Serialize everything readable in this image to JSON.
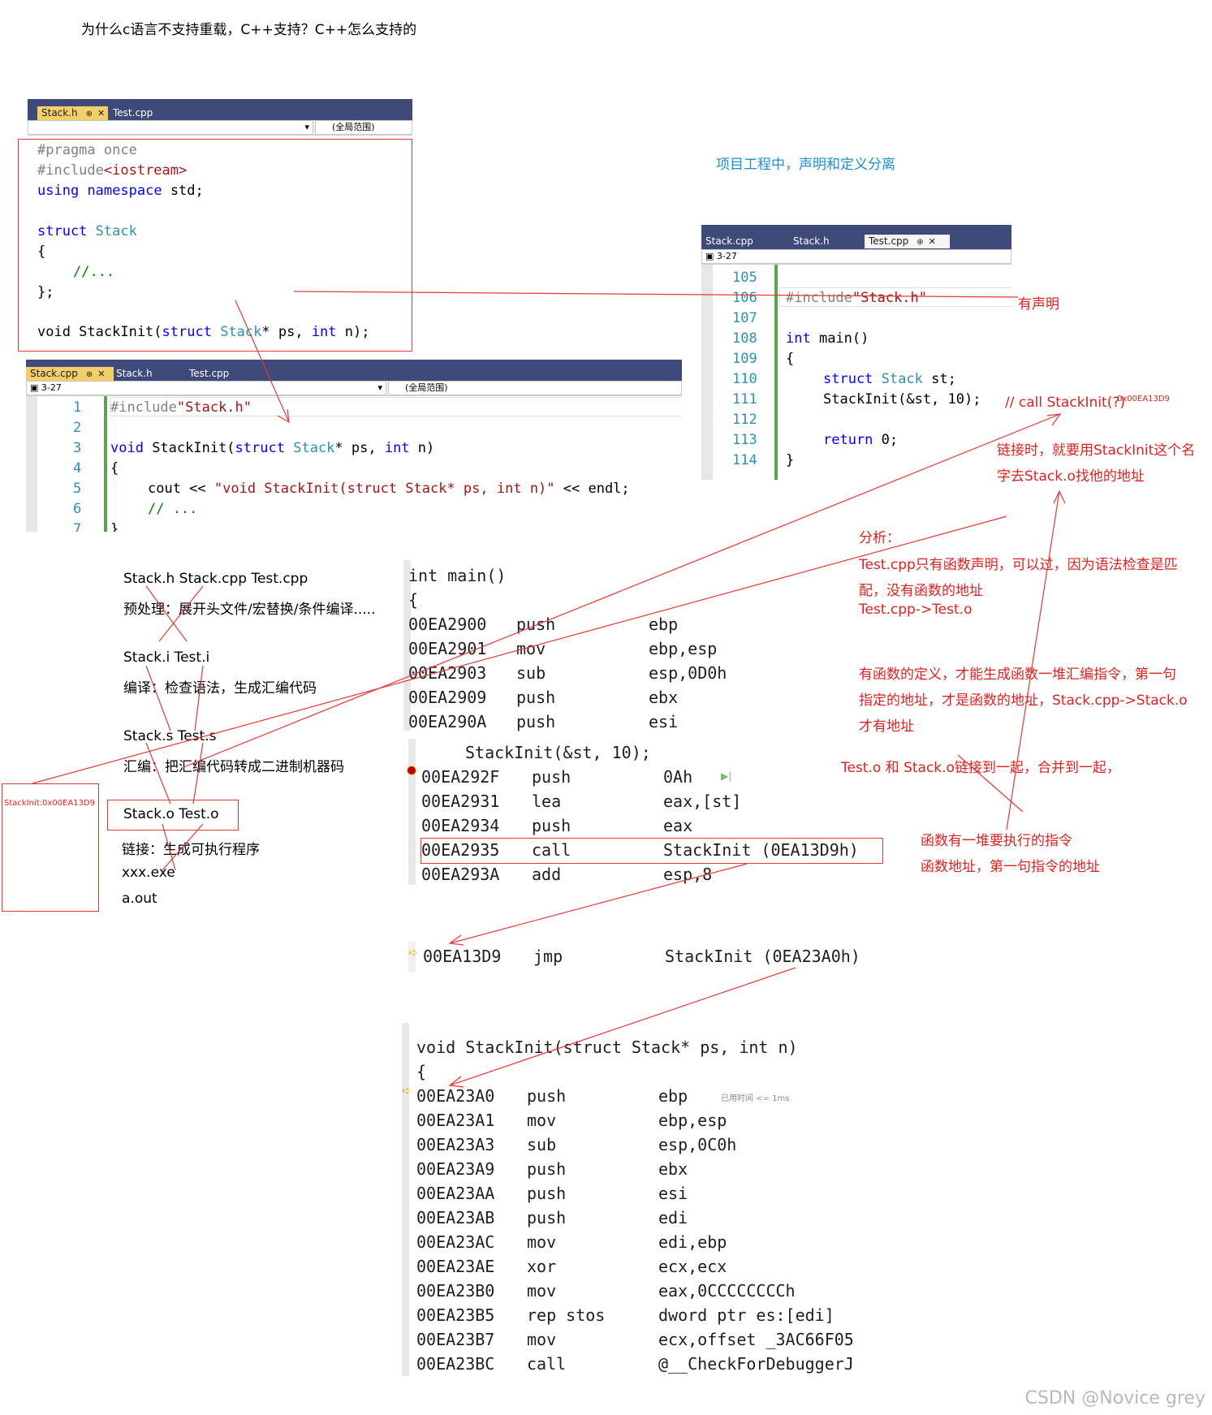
{
  "title": "为什么c语言不支持重载，C++支持？C++怎么支持的",
  "editor_stack_h": {
    "tabs": [
      "Stack.h",
      "Test.cpp"
    ],
    "tab_pin": "⊕",
    "tab_close": "✕",
    "nav_scope": "(全局范围)",
    "lines": {
      "l1": "#pragma once",
      "l2a": "#include",
      "l2b": "<iostream>",
      "l3a": "using",
      "l3b": "namespace",
      "l3c": "std;",
      "l5a": "struct",
      "l5b": "Stack",
      "l6": "{",
      "l7": "//...",
      "l8": "};",
      "l10a": "void StackInit(",
      "l10b": "struct",
      "l10c": "Stack",
      "l10d": "* ps, ",
      "l10e": "int",
      "l10f": " n);"
    }
  },
  "editor_stack_cpp": {
    "tabs": [
      "Stack.cpp",
      "Stack.h",
      "Test.cpp"
    ],
    "tab_pin": "⊕",
    "tab_close": "✕",
    "nav_left": "3-27",
    "nav_scope": "(全局范围)",
    "line_numbers": [
      "1",
      "2",
      "3",
      "4",
      "5",
      "6",
      "7"
    ],
    "lines": {
      "l1a": "#include",
      "l1b": "\"Stack.h\"",
      "l3a": "void",
      "l3b": " StackInit(",
      "l3c": "struct",
      "l3d": "Stack",
      "l3e": "* ps, ",
      "l3f": "int",
      "l3g": " n)",
      "l4": "{",
      "l5a": "cout << ",
      "l5b": "\"void StackInit(struct Stack* ps, int n)\"",
      "l5c": " << endl;",
      "l6": "// ...",
      "l7": "}"
    }
  },
  "editor_test_cpp": {
    "tabs": [
      "Stack.cpp",
      "Stack.h",
      "Test.cpp"
    ],
    "tab_pin": "⊕",
    "tab_close": "✕",
    "nav_left": "3-27",
    "line_numbers": [
      "105",
      "106",
      "107",
      "108",
      "109",
      "110",
      "111",
      "112",
      "113",
      "114"
    ],
    "lines": {
      "l106a": "#include",
      "l106b": "\"Stack.h\"",
      "l108a": "int",
      "l108b": " main()",
      "l109": "{",
      "l110a": "struct",
      "l110b": "Stack",
      "l110c": " st;",
      "l111": "StackInit(&st, 10);",
      "l113a": "return",
      "l113b": " 0;",
      "l114": "}"
    }
  },
  "notes": {
    "project_sep": "项目工程中，声明和定义分离",
    "has_decl": "有声明",
    "call_comment": "// call  StackInit(?)",
    "call_addr": "0x00EA13D9",
    "link_1": "链接时，就要用StackInit这个名",
    "link_2": "字去Stack.o找他的地址",
    "analysis_title": "分析：",
    "analysis_1": "Test.cpp只有函数声明，可以过，因为语法检查是匹",
    "analysis_2": "配，没有函数的地址",
    "analysis_3": "Test.cpp->Test.o",
    "def_1": "有函数的定义，才能生成函数一堆汇编指令，第一句",
    "def_2": "指定的地址，才是函数的地址，Stack.cpp->Stack.o",
    "def_3": "才有地址",
    "merge": "Test.o 和 Stack.o链接到一起，合并到一起，",
    "func_1": "函数有一堆要执行的指令",
    "func_2": "函数地址，第一句指令的地址",
    "symbol": "StackInit:0x00EA13D9"
  },
  "flow": {
    "files": "Stack.h  Stack.cpp  Test.cpp",
    "preprocess": "预处理：展开头文件/宏替换/条件编译.....",
    "i_files": "Stack.i  Test.i",
    "compile": "编译：检查语法，生成汇编代码",
    "s_files": "Stack.s Test.s",
    "assemble": "汇编：把汇编代码转成二进制机器码",
    "o_files": "Stack.o Test.o",
    "link": "链接：生成可执行程序",
    "exe": "xxx.exe",
    "aout": "a.out"
  },
  "asm_main": {
    "header": "int main()",
    "brace": "{",
    "rows": [
      [
        "00EA2900",
        "push",
        "ebp"
      ],
      [
        "00EA2901",
        "mov",
        "ebp,esp"
      ],
      [
        "00EA2903",
        "sub",
        "esp,0D0h"
      ],
      [
        "00EA2909",
        "push",
        "ebx"
      ],
      [
        "00EA290A",
        "push",
        "esi"
      ]
    ],
    "call_src": "StackInit(&st, 10);",
    "call_rows": [
      [
        "00EA292F",
        "push",
        "0Ah"
      ],
      [
        "00EA2931",
        "lea",
        "eax,[st]"
      ],
      [
        "00EA2934",
        "push",
        "eax"
      ],
      [
        "00EA2935",
        "call",
        "StackInit (0EA13D9h)"
      ],
      [
        "00EA293A",
        "add",
        "esp,8"
      ]
    ]
  },
  "asm_jmp": [
    "00EA13D9",
    "jmp",
    "StackInit (0EA23A0h)"
  ],
  "asm_func": {
    "header": "void StackInit(struct Stack* ps, int n)",
    "brace": "{",
    "elapsed": "已用时间 <= 1ms",
    "rows": [
      [
        "00EA23A0",
        "push",
        "ebp"
      ],
      [
        "00EA23A1",
        "mov",
        "ebp,esp"
      ],
      [
        "00EA23A3",
        "sub",
        "esp,0C0h"
      ],
      [
        "00EA23A9",
        "push",
        "ebx"
      ],
      [
        "00EA23AA",
        "push",
        "esi"
      ],
      [
        "00EA23AB",
        "push",
        "edi"
      ],
      [
        "00EA23AC",
        "mov",
        "edi,ebp"
      ],
      [
        "00EA23AE",
        "xor",
        "ecx,ecx"
      ],
      [
        "00EA23B0",
        "mov",
        "eax,0CCCCCCCCh"
      ],
      [
        "00EA23B5",
        "rep stos",
        "dword ptr es:[edi]"
      ],
      [
        "00EA23B7",
        "mov",
        "ecx,offset _3AC66F05"
      ],
      [
        "00EA23BC",
        "call",
        "@__CheckForDebuggerJ"
      ]
    ]
  },
  "watermark": "CSDN @Novice grey",
  "colors": {
    "keyword": "#0000ff",
    "type": "#2b91af",
    "string": "#a31515",
    "comment": "#008000",
    "annotation": "#e02020",
    "blue_note": "#1a8fd6"
  }
}
